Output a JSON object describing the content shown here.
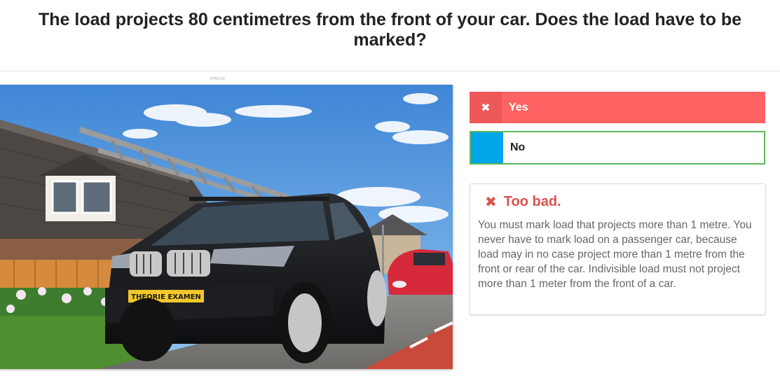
{
  "question": {
    "text": "The load projects 80 centimetres from the front of your car. Does the load have to be marked?"
  },
  "image": {
    "caption": "ETRS-02",
    "plate_text": "THEORIE EXAMEN"
  },
  "answers": [
    {
      "label": "Yes",
      "state": "wrong",
      "icon": "close-icon",
      "color": "#ff6363"
    },
    {
      "label": "No",
      "state": "correct",
      "color": "#00a6e8",
      "border": "#5cb85c"
    }
  ],
  "feedback": {
    "icon": "close-icon",
    "title": "Too bad.",
    "body": "You must mark load that projects more than 1 metre. You never have to mark load on a passenger car, because load may in no case project more than 1 metre from the front or rear of the car. Indivisible load must not project more than 1 meter from the front of a car.",
    "color": "#d9534f"
  }
}
